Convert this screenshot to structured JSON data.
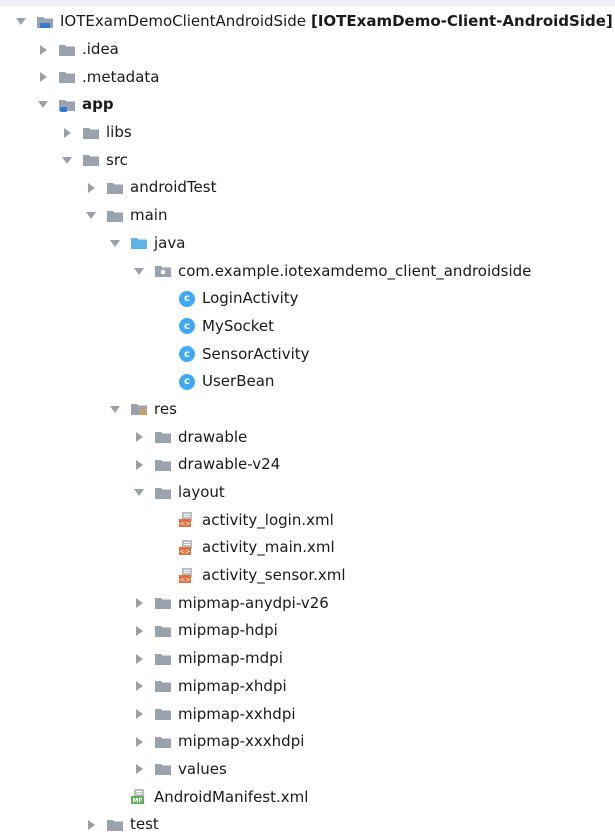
{
  "project_tree": {
    "root": {
      "label": "IOTExamDemoClientAndroidSide",
      "module_label": "[IOTExamDemo-Client-AndroidSide]"
    },
    "idea": ".idea",
    "metadata": ".metadata",
    "app": "app",
    "libs": "libs",
    "src": "src",
    "androidTest": "androidTest",
    "main": "main",
    "java": "java",
    "package": "com.example.iotexamdemo_client_androidside",
    "class_badge": "c",
    "classes": [
      "LoginActivity",
      "MySocket",
      "SensorActivity",
      "UserBean"
    ],
    "res": "res",
    "drawable": "drawable",
    "drawable_v24": "drawable-v24",
    "layout": "layout",
    "layouts": [
      "activity_login.xml",
      "activity_main.xml",
      "activity_sensor.xml"
    ],
    "mipmaps": [
      "mipmap-anydpi-v26",
      "mipmap-hdpi",
      "mipmap-mdpi",
      "mipmap-xhdpi",
      "mipmap-xxhdpi",
      "mipmap-xxxhdpi"
    ],
    "values": "values",
    "manifest": "AndroidManifest.xml",
    "test": "test"
  }
}
